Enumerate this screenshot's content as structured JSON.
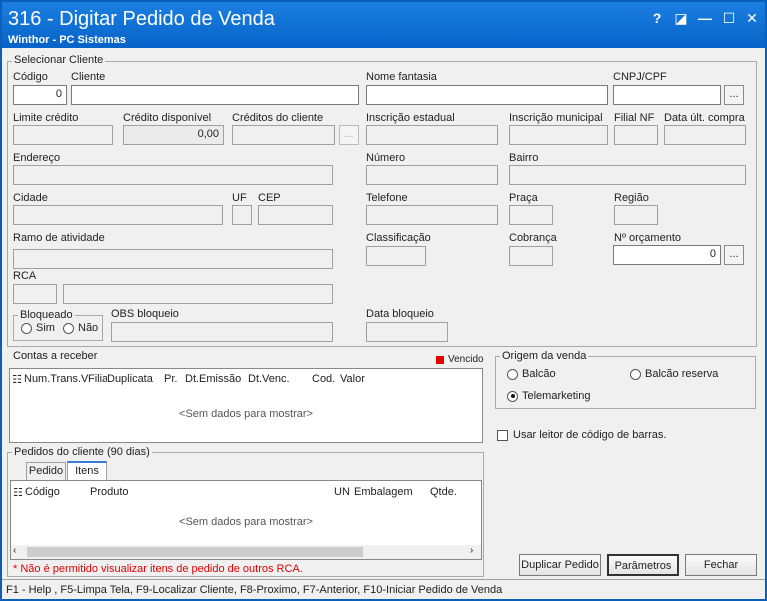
{
  "window": {
    "title": "316 - Digitar Pedido de Venda",
    "subtitle": "Winthor - PC Sistemas",
    "controls": {
      "help": "?",
      "restore": "◪",
      "minimize": "—",
      "maximize": "☐",
      "close": "✕"
    }
  },
  "cliente": {
    "group_title": "Selecionar Cliente",
    "codigo_label": "Código",
    "codigo_value": "0",
    "cliente_label": "Cliente",
    "cliente_value": "",
    "nome_fantasia_label": "Nome fantasia",
    "cnpj_label": "CNPJ/CPF",
    "ellipsis": "...",
    "limite_credito_label": "Limite crédito",
    "credito_disponivel_label": "Crédito disponível",
    "credito_disponivel_value": "0,00",
    "creditos_cliente_label": "Créditos do cliente",
    "inscricao_estadual_label": "Inscrição estadual",
    "inscricao_municipal_label": "Inscrição municipal",
    "filial_nf_label": "Filial NF",
    "data_ult_compra_label": "Data últ. compra",
    "endereco_label": "Endereço",
    "numero_label": "Número",
    "bairro_label": "Bairro",
    "cidade_label": "Cidade",
    "uf_label": "UF",
    "cep_label": "CEP",
    "telefone_label": "Telefone",
    "praca_label": "Praça",
    "regiao_label": "Região",
    "ramo_label": "Ramo de atividade",
    "classificacao_label": "Classificação",
    "cobranca_label": "Cobrança",
    "orcamento_label": "Nº orçamento",
    "orcamento_value": "0",
    "rca_label": "RCA",
    "bloqueado_label": "Bloqueado",
    "bloqueado_sim": "Sim",
    "bloqueado_nao": "Não",
    "obs_bloqueio_label": "OBS bloqueio",
    "data_bloqueio_label": "Data bloqueio"
  },
  "contas": {
    "group_title": "Contas a receber",
    "vencido_label": "Vencido",
    "vencido_color": "#e00000",
    "columns": [
      "Num.Trans.V",
      "Filia",
      "Duplicata",
      "Pr.",
      "Dt.Emissão",
      "Dt.Venc.",
      "Cod.",
      "Valor"
    ],
    "empty": "<Sem dados para mostrar>"
  },
  "origem": {
    "group_title": "Origem da venda",
    "balcao": "Balcão",
    "balcao_reserva": "Balcão reserva",
    "telemarketing": "Telemarketing",
    "selected": "Telemarketing"
  },
  "leitor_label": "Usar leitor de código de barras.",
  "pedidos": {
    "group_title": "Pedidos do cliente (90 dias)",
    "tab_pedido": "Pedido",
    "tab_itens": "Itens",
    "columns": [
      "Código",
      "Produto",
      "UN",
      "Embalagem",
      "Qtde."
    ],
    "empty": "<Sem dados para mostrar>",
    "warning": "* Não é permitido visualizar itens de pedido de outros RCA."
  },
  "buttons": {
    "duplicar": "Duplicar Pedido",
    "parametros": "Parâmetros",
    "fechar": "Fechar"
  },
  "status_bar": "F1 - Help , F5-Limpa Tela, F9-Localizar Cliente, F8-Proximo, F7-Anterior, F10-Iniciar Pedido de Venda"
}
